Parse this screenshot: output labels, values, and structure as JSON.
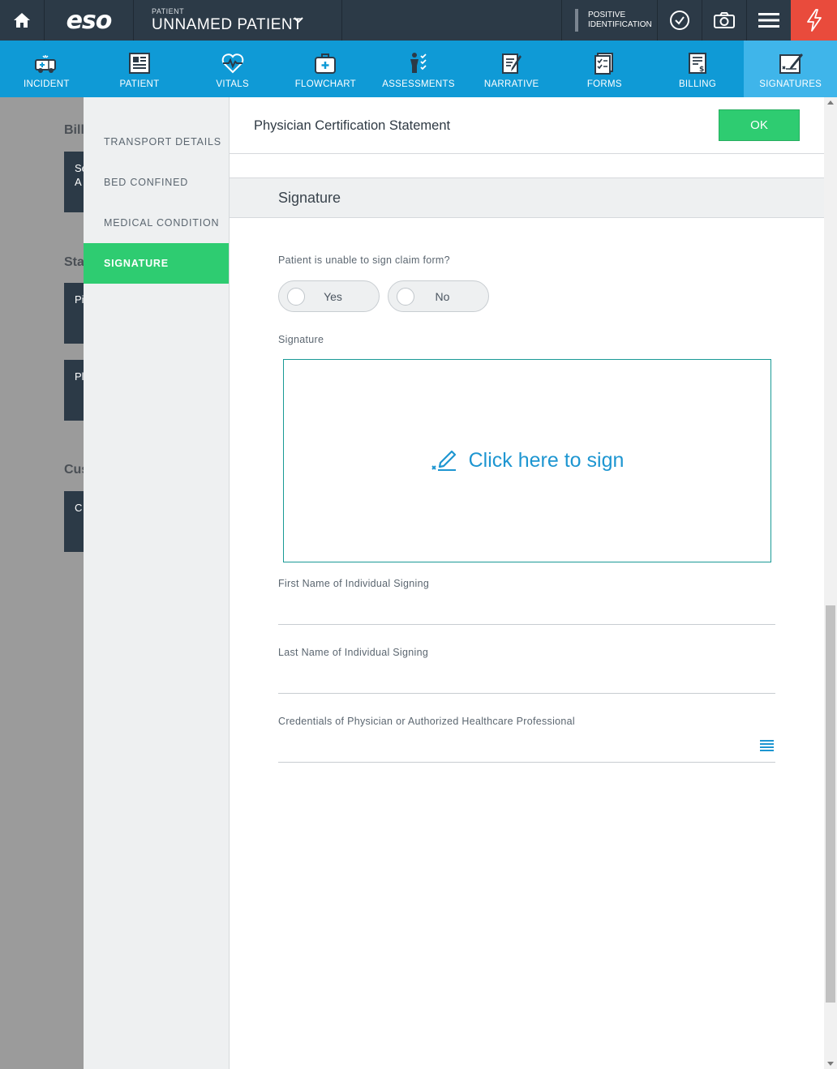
{
  "topbar": {
    "logo": "eso",
    "patient_small": "PATIENT",
    "patient_name": "UNNAMED PATIENT",
    "positive_id_line1": "POSITIVE",
    "positive_id_line2": "IDENTIFICATION"
  },
  "nav": {
    "items": [
      {
        "label": "INCIDENT",
        "icon": "ambulance-icon"
      },
      {
        "label": "PATIENT",
        "icon": "patient-card-icon"
      },
      {
        "label": "VITALS",
        "icon": "heartbeat-icon"
      },
      {
        "label": "FLOWCHART",
        "icon": "medkit-icon"
      },
      {
        "label": "ASSESSMENTS",
        "icon": "body-checklist-icon"
      },
      {
        "label": "NARRATIVE",
        "icon": "narrative-pen-icon"
      },
      {
        "label": "FORMS",
        "icon": "forms-icon"
      },
      {
        "label": "BILLING",
        "icon": "billing-icon"
      },
      {
        "label": "SIGNATURES",
        "icon": "signature-icon"
      }
    ],
    "active": "SIGNATURES"
  },
  "background": {
    "label1": "Bill",
    "card1_line1": "Se",
    "card1_line2": "A",
    "label2": "Sta",
    "card2": "Pi",
    "card3": "Pl",
    "label3": "Cus",
    "card4": "C"
  },
  "sidebar": {
    "items": [
      {
        "label": "TRANSPORT DETAILS"
      },
      {
        "label": "BED CONFINED"
      },
      {
        "label": "MEDICAL CONDITION"
      },
      {
        "label": "SIGNATURE"
      }
    ],
    "active": "SIGNATURE"
  },
  "modal": {
    "title": "Physician Certification Statement",
    "ok_label": "OK",
    "section_title": "Signature",
    "question": "Patient is unable to sign claim form?",
    "yes_label": "Yes",
    "no_label": "No",
    "signature_label": "Signature",
    "signature_cta": "Click here to sign",
    "first_name_label": "First Name of Individual Signing",
    "first_name_value": "",
    "last_name_label": "Last Name of Individual Signing",
    "last_name_value": "",
    "credentials_label": "Credentials of Physician or Authorized Healthcare Professional",
    "credentials_value": ""
  },
  "colors": {
    "topbar": "#2c3a47",
    "nav": "#0f9ad6",
    "nav_active": "#3fb5ea",
    "accent_green": "#2ecc71",
    "alert_red": "#e94b3c",
    "link_blue": "#1e96d1"
  }
}
